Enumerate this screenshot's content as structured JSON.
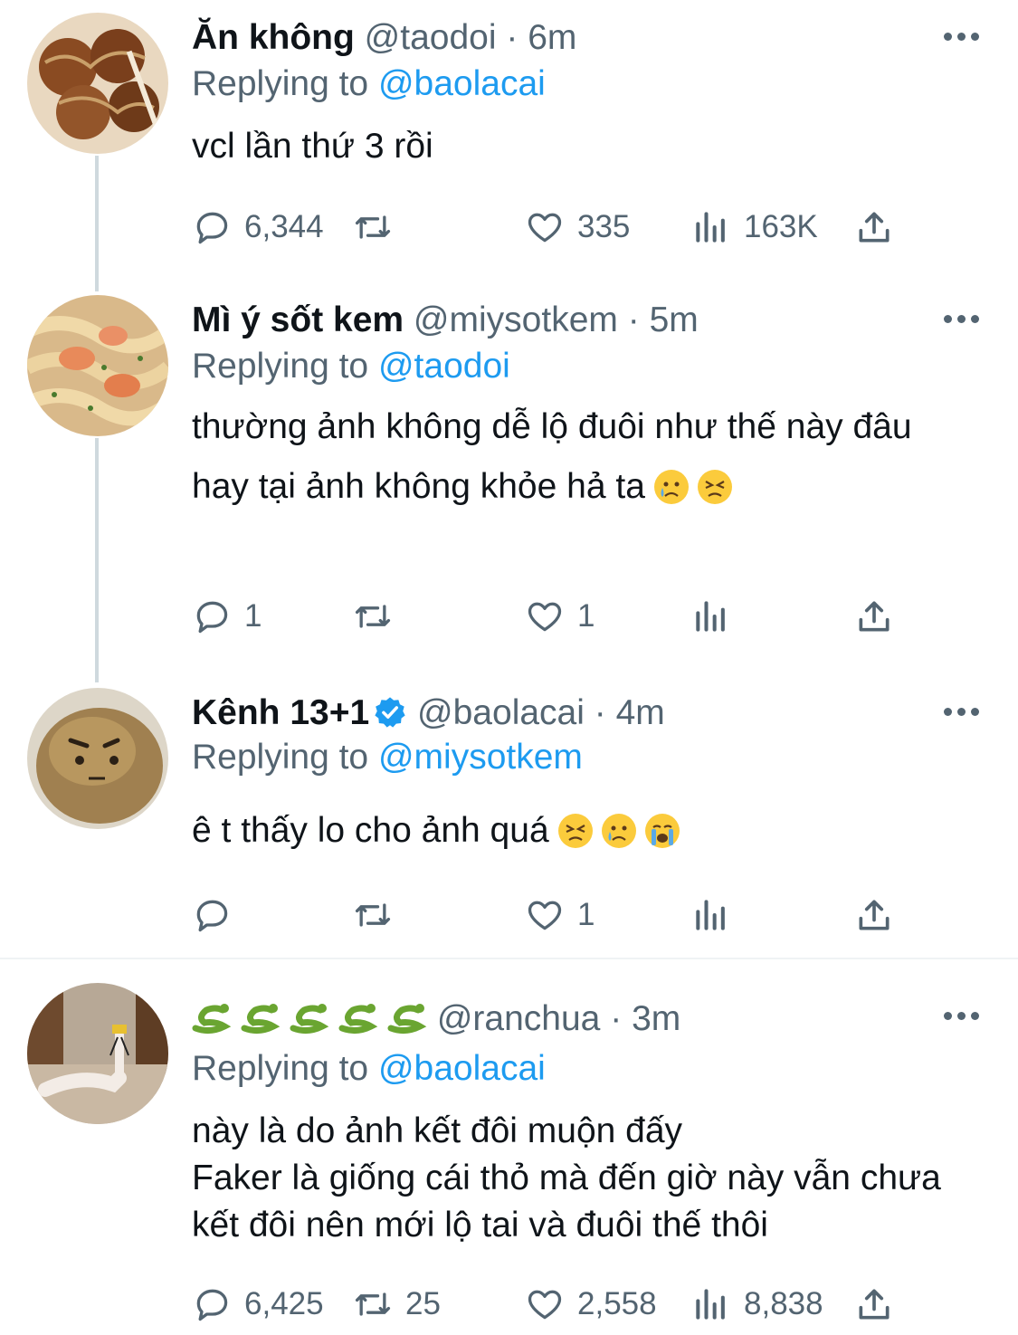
{
  "tweets": [
    {
      "name": "Ăn không",
      "handle": "@taodoi",
      "dot": "·",
      "time": "6m",
      "replying_prefix": "Replying to ",
      "replying_to": "@baolacai",
      "lines": [
        "vcl lần thứ 3 rồi"
      ],
      "replies": "6,344",
      "retweets": "",
      "likes": "335",
      "views": "163K"
    },
    {
      "name": "Mì ý sốt kem",
      "handle": "@miysotkem",
      "dot": "·",
      "time": "5m",
      "replying_prefix": "Replying to ",
      "replying_to": "@taodoi",
      "lines": [
        "thường ảnh không dễ lộ đuôi như thế này đâu",
        "hay tại ảnh không khỏe hả ta"
      ],
      "replies": "1",
      "retweets": "",
      "likes": "1",
      "views": ""
    },
    {
      "name": "Kênh 13+1",
      "handle": "@baolacai",
      "dot": "·",
      "time": "4m",
      "replying_prefix": "Replying to ",
      "replying_to": "@miysotkem",
      "lines": [
        "ê t thấy lo cho ảnh quá"
      ],
      "replies": "",
      "retweets": "",
      "likes": "1",
      "views": ""
    },
    {
      "name": "",
      "handle": "@ranchua",
      "dot": "·",
      "time": "3m",
      "replying_prefix": "Replying to ",
      "replying_to": "@baolacai",
      "lines": [
        "này là do ảnh kết đôi muộn đấy",
        "Faker là giống cái thỏ mà đến giờ này vẫn chưa kết đôi nên mới lộ tai và đuôi thế thôi"
      ],
      "replies": "6,425",
      "retweets": "25",
      "likes": "2,558",
      "views": "8,838"
    }
  ],
  "colors": {
    "text": "#0f1419",
    "secondary": "#536471",
    "link": "#1d9bf0",
    "thread_line": "#cfd9de",
    "divider": "#eff3f4"
  },
  "icons": {
    "reply": "speech-bubble-icon",
    "retweet": "retweet-arrows-icon",
    "like": "heart-icon",
    "views": "bar-chart-icon",
    "share": "share-upload-icon",
    "more": "ellipsis-icon",
    "verified": "verified-badge-icon"
  }
}
